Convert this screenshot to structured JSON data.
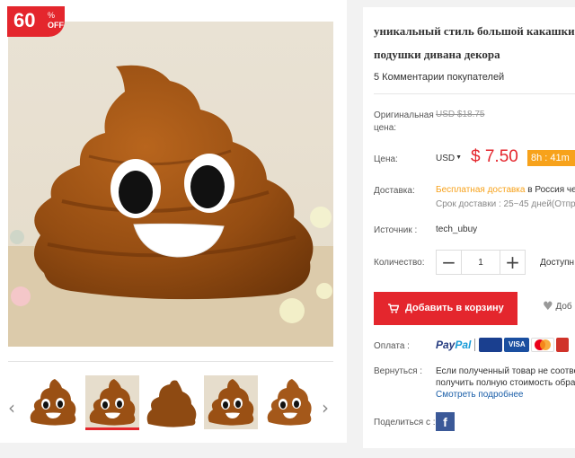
{
  "badge": {
    "percent": "60",
    "symbol": "%",
    "off": "OFF"
  },
  "product": {
    "title_line1": "уникальный стиль большой какашки",
    "title_line2": "подушки дивана декора",
    "reviews": "5 Комментарии покупателей"
  },
  "labels": {
    "original_price_1": "Оригинальная",
    "original_price_2": "цена:",
    "price": "Цена:",
    "delivery": "Доставка:",
    "source": "Источник :",
    "quantity": "Количество:",
    "payment": "Оплата :",
    "returns": "Вернуться :",
    "share": "Поделиться с :"
  },
  "price": {
    "original": "USD $18.75",
    "currency": "USD",
    "current": "$ 7.50",
    "timer": "8h : 41m"
  },
  "delivery": {
    "free": "Бесплатная доставка",
    "to": "в Россия че",
    "term": "Срок доставки : 25~45 дней(Отпр"
  },
  "source": {
    "value": "tech_ubuy"
  },
  "quantity": {
    "value": "1",
    "available": "Доступн"
  },
  "buttons": {
    "add_to_cart": "Добавить в корзину",
    "wishlist": "Доб"
  },
  "payment": {
    "paypal_a": "Pay",
    "paypal_b": "Pal",
    "cards": [
      "Electron",
      "VISA",
      "MC",
      "Maestro"
    ]
  },
  "returns": {
    "line1": "Если полученный товар не соотве",
    "line2": "получить полную стоимость обра",
    "more": "Смотреть подробнее"
  },
  "share": {
    "icon_letter": "f"
  },
  "colors": {
    "accent": "#e4262d",
    "timer": "#f7a21b",
    "link": "#1a5ea8",
    "facebook": "#3b5998"
  },
  "icons": [
    "chevron-left-icon",
    "chevron-right-icon",
    "cart-icon",
    "heart-icon",
    "facebook-icon"
  ]
}
